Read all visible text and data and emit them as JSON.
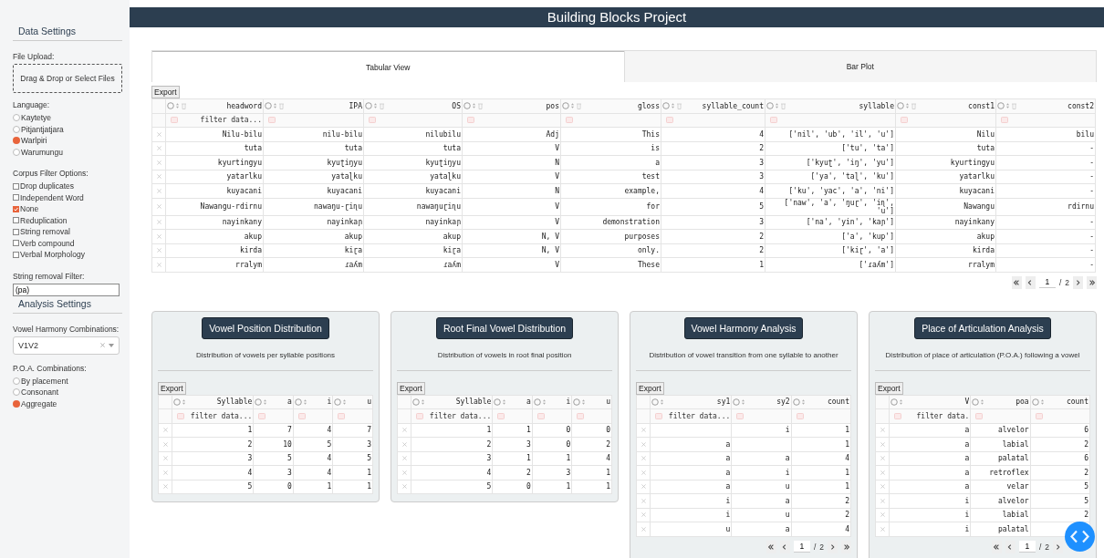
{
  "header": {
    "title": "Building Blocks Project"
  },
  "sidebar": {
    "data_title": "Data Settings",
    "file_upload": {
      "label": "File Upload:",
      "dropzone": "Drag & Drop or Select Files"
    },
    "language": {
      "label": "Language:",
      "options": [
        {
          "label": "Kaytetye",
          "selected": false
        },
        {
          "label": "Pitjantjatjara",
          "selected": false
        },
        {
          "label": "Warlpiri",
          "selected": true
        },
        {
          "label": "Warumungu",
          "selected": false
        }
      ]
    },
    "corpus_filter": {
      "label": "Corpus Filter Options:",
      "options": [
        {
          "label": "Drop duplicates",
          "checked": false
        },
        {
          "label": "Independent Word",
          "checked": false
        },
        {
          "label": "None",
          "checked": true
        },
        {
          "label": "Reduplication",
          "checked": false
        },
        {
          "label": "String removal",
          "checked": false
        },
        {
          "label": "Verb compound",
          "checked": false
        },
        {
          "label": "Verbal Morphology",
          "checked": false
        }
      ]
    },
    "string_filter": {
      "label": "String removal Filter:",
      "value": "(pa)"
    },
    "analysis_title": "Analysis Settings",
    "vowel_harmony": {
      "label": "Vowel Harmony Combinations:",
      "value": "V1V2"
    },
    "poa": {
      "label": "P.O.A. Combinations:",
      "options": [
        {
          "label": "By placement",
          "selected": false
        },
        {
          "label": "Consonant",
          "selected": false
        },
        {
          "label": "Aggregate",
          "selected": true
        }
      ]
    }
  },
  "tabs": [
    {
      "label": "Tabular View",
      "selected": true
    },
    {
      "label": "Bar Plot",
      "selected": false
    }
  ],
  "main_table": {
    "export": "Export",
    "filter_placeholder": "filter data...",
    "columns": [
      "headword",
      "IPA",
      "OS",
      "pos",
      "gloss",
      "syllable_count",
      "syllable",
      "const1",
      "const2"
    ],
    "rows": [
      [
        "Nilu-bilu",
        "nilu-bilu",
        "nilubilu",
        "Adj",
        "This",
        "4",
        "['nil', 'ub', 'il', 'u']",
        "Nilu",
        "bilu"
      ],
      [
        "tuta",
        "tuta",
        "tuta",
        "V",
        "is",
        "2",
        "['tu', 'ta']",
        "tuta",
        "-"
      ],
      [
        "kyurtingyu",
        "kyuʈiŋyu",
        "kyuʈiŋyu",
        "N",
        "a",
        "3",
        "['kyuʈ', 'iŋ', 'yu']",
        "kyurtingyu",
        "-"
      ],
      [
        "yatarlku",
        "yataɭku",
        "yataɭku",
        "V",
        "test",
        "3",
        "['ya', 'taɭ', 'ku']",
        "yatarlku",
        "-"
      ],
      [
        "kuyacani",
        "kuyacani",
        "kuyacani",
        "N",
        "example,",
        "4",
        "['ku', 'yac', 'a', 'ni']",
        "kuyacani",
        "-"
      ],
      [
        "Nawangu-rdirnu",
        "nawaŋu-ɽiɳu",
        "nawaŋuɽiɳu",
        "V",
        "for",
        "5",
        "['naw', 'a', 'ŋuɽ', 'iɳ', 'u']",
        "Nawangu",
        "rdirnu"
      ],
      [
        "nayinkany",
        "nayinkaɲ",
        "nayinkaɲ",
        "V",
        "demonstration",
        "3",
        "['na', 'yin', 'kaɲ']",
        "nayinkany",
        "-"
      ],
      [
        "akup",
        "akup",
        "akup",
        "N, V",
        "purposes",
        "2",
        "['a', 'kup']",
        "akup",
        "-"
      ],
      [
        "kirda",
        "kiɽa",
        "kiɽa",
        "N, V",
        "only.",
        "2",
        "['kiɽ', 'a']",
        "kirda",
        "-"
      ],
      [
        "rralym",
        "ɾaʎm",
        "ɾaʎm",
        "V",
        "These",
        "1",
        "['ɾaʎm']",
        "rralym",
        "-"
      ]
    ],
    "pagination": {
      "current": "1",
      "separator": "/",
      "total": "2"
    }
  },
  "panels": [
    {
      "title": "Vowel Position Distribution",
      "description": "Distribution of vowels per syllable positions",
      "table": {
        "export": "Export",
        "filter_placeholder": "filter data...",
        "columns": [
          "Syllable",
          "a",
          "i",
          "u"
        ],
        "rows": [
          [
            "1",
            "7",
            "4",
            "7"
          ],
          [
            "2",
            "10",
            "5",
            "3"
          ],
          [
            "3",
            "5",
            "4",
            "5"
          ],
          [
            "4",
            "3",
            "4",
            "1"
          ],
          [
            "5",
            "0",
            "1",
            "1"
          ]
        ]
      }
    },
    {
      "title": "Root Final Vowel Distribution",
      "description": "Distribution of vowels in root final position",
      "table": {
        "export": "Export",
        "filter_placeholder": "filter data...",
        "columns": [
          "Syllable",
          "a",
          "i",
          "u"
        ],
        "rows": [
          [
            "1",
            "1",
            "0",
            "0"
          ],
          [
            "2",
            "3",
            "0",
            "2"
          ],
          [
            "3",
            "1",
            "1",
            "4"
          ],
          [
            "4",
            "2",
            "3",
            "1"
          ],
          [
            "5",
            "0",
            "1",
            "1"
          ]
        ]
      }
    },
    {
      "title": "Vowel Harmony Analysis",
      "description": "Distribution of vowel transition from one syllable to another",
      "table": {
        "export": "Export",
        "filter_placeholder": "filter data...",
        "columns": [
          "sy1",
          "sy2",
          "count"
        ],
        "rows": [
          [
            null,
            "i",
            "1"
          ],
          [
            "a",
            null,
            "1"
          ],
          [
            "a",
            "a",
            "4"
          ],
          [
            "a",
            "i",
            "1"
          ],
          [
            "a",
            "u",
            "1"
          ],
          [
            "i",
            "a",
            "2"
          ],
          [
            "i",
            "u",
            "2"
          ],
          [
            "u",
            "a",
            "4"
          ]
        ],
        "pagination": {
          "current": "1",
          "separator": "/",
          "total": "2"
        }
      }
    },
    {
      "title": "Place of Articulation Analysis",
      "description": "Distribution of place of articulation (P.O.A.) following a vowel",
      "table": {
        "export": "Export",
        "filter_placeholder": "filter data.",
        "columns": [
          "V",
          "poa",
          "count"
        ],
        "rows": [
          [
            "a",
            "alvelor",
            "6"
          ],
          [
            "a",
            "labial",
            "2"
          ],
          [
            "a",
            "palatal",
            "6"
          ],
          [
            "a",
            "retroflex",
            "2"
          ],
          [
            "a",
            "velar",
            "5"
          ],
          [
            "i",
            "alvelor",
            "5"
          ],
          [
            "i",
            "labial",
            "2"
          ],
          [
            "i",
            "palatal",
            null
          ]
        ],
        "pagination": {
          "current": "1",
          "separator": "/",
          "total": "2"
        }
      }
    }
  ]
}
